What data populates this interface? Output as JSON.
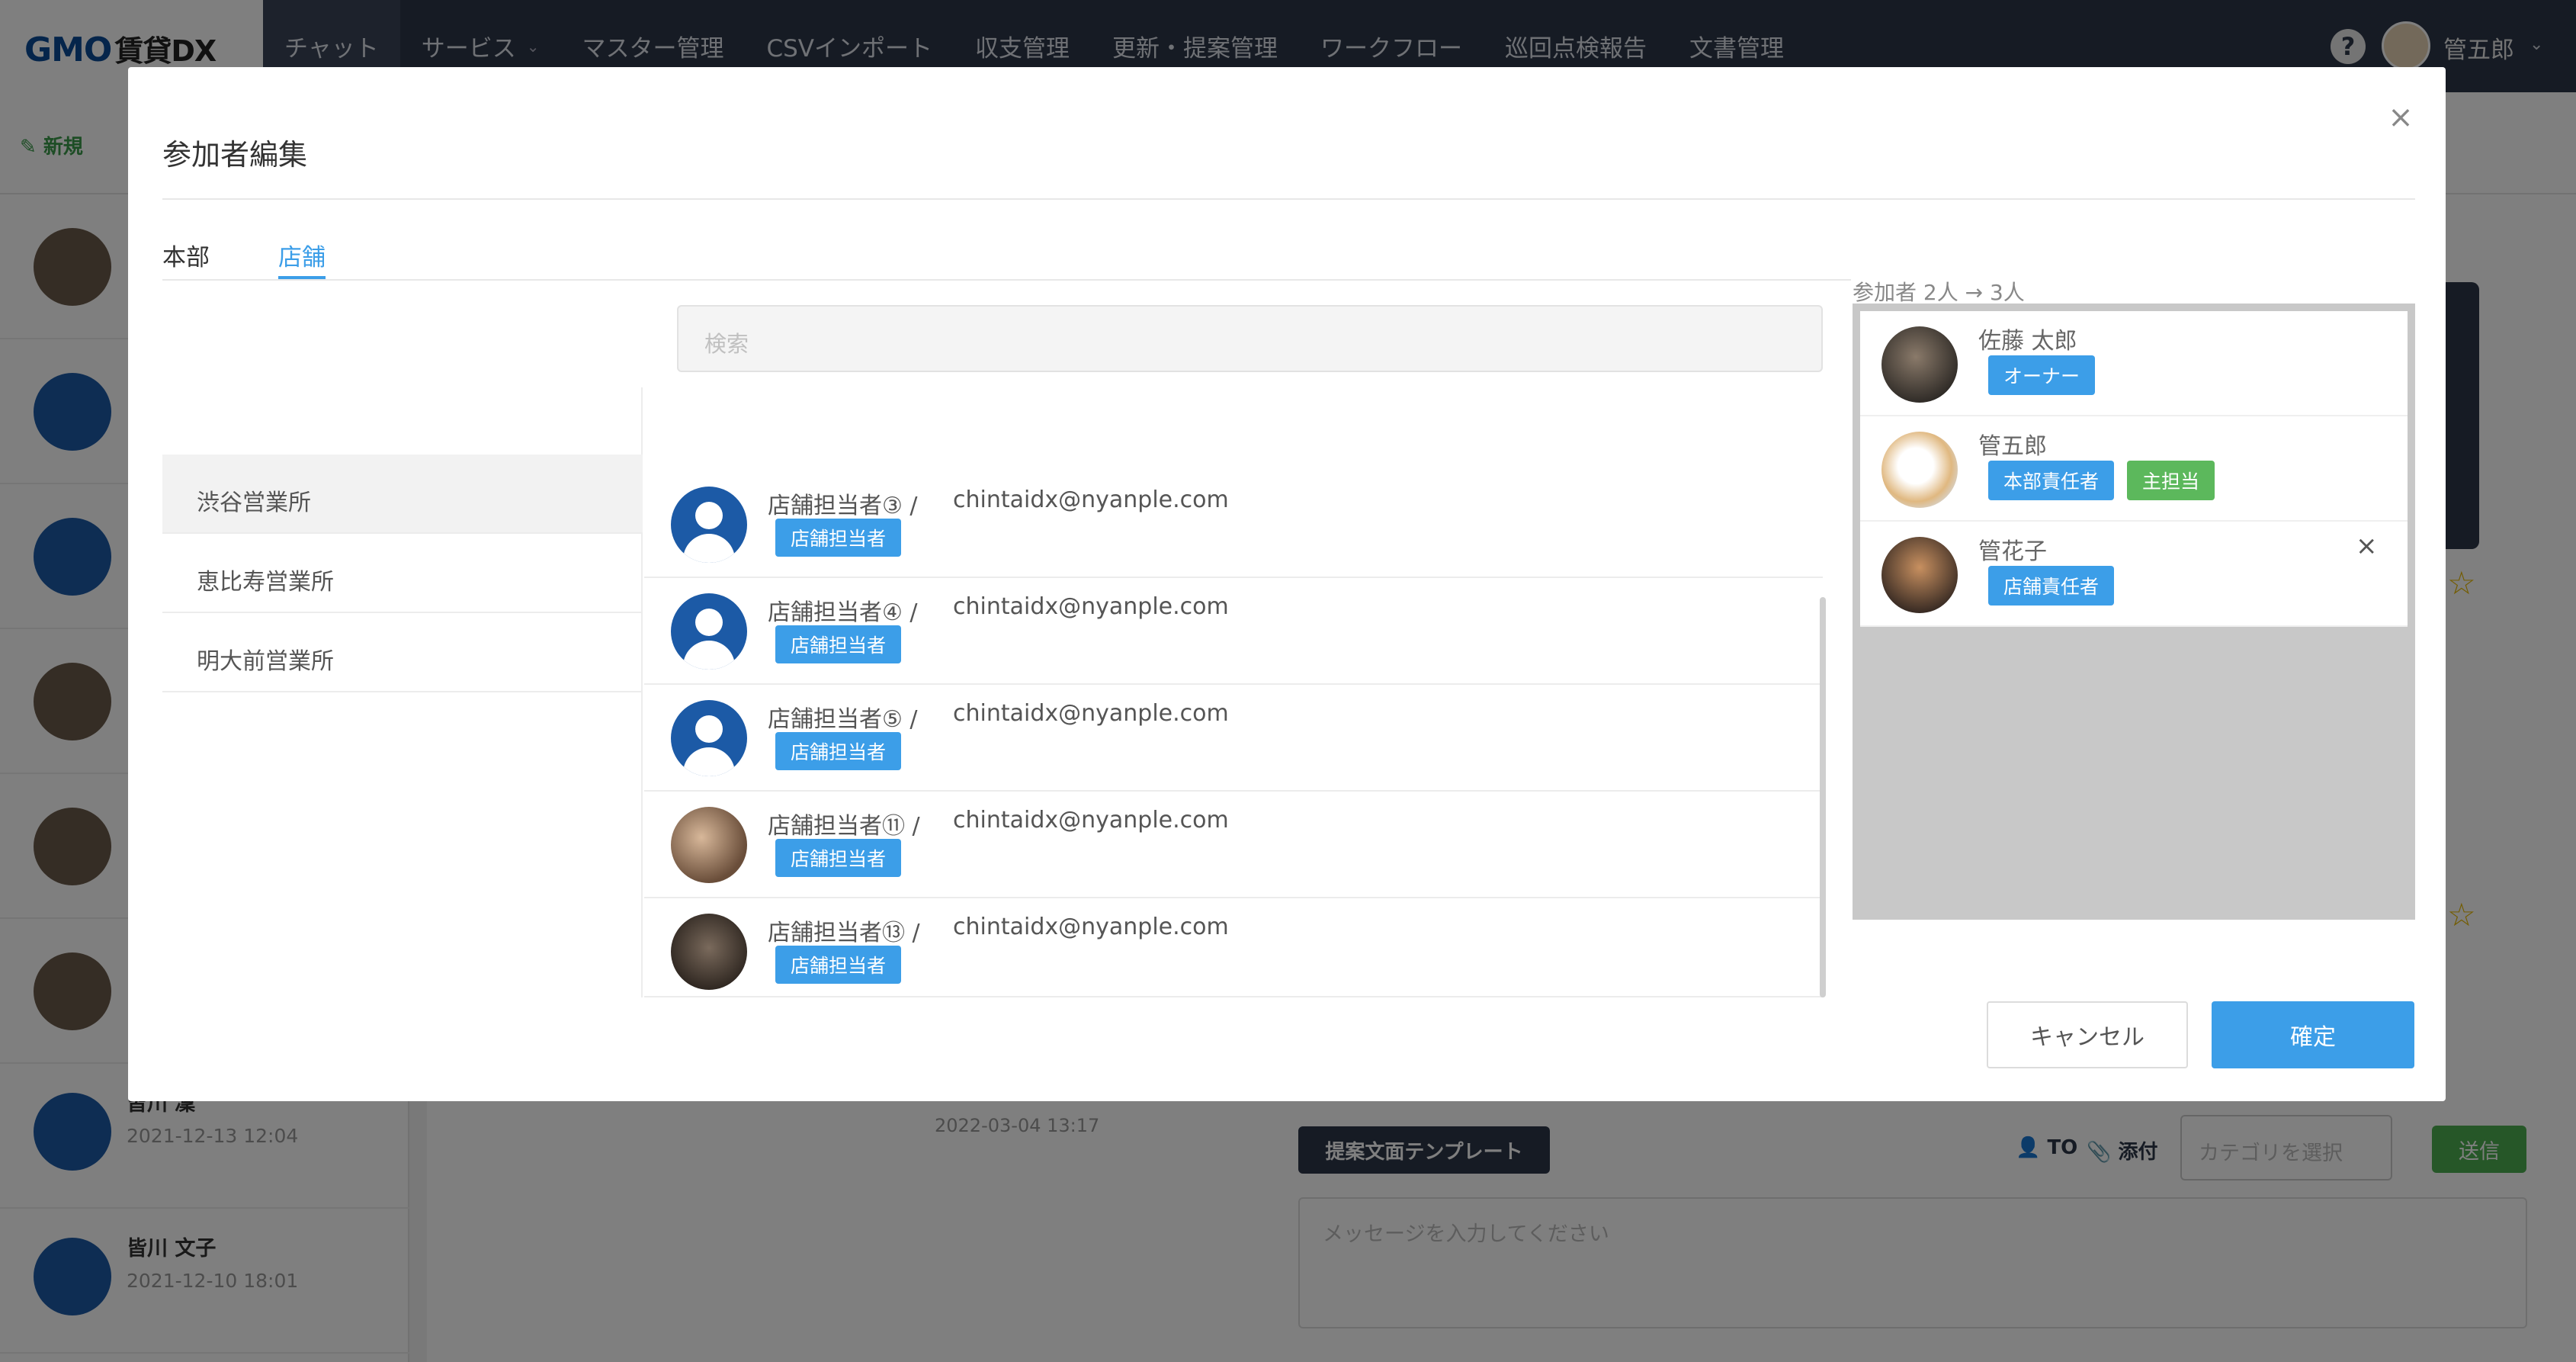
{
  "app": {
    "logo": "GMO",
    "logo_sub": "賃貸DX",
    "nav": [
      {
        "label": "チャット"
      },
      {
        "label": "サービス",
        "caret": "⌄"
      },
      {
        "label": "マスター管理"
      },
      {
        "label": "CSVインポート"
      },
      {
        "label": "収支管理"
      },
      {
        "label": "更新・提案管理"
      },
      {
        "label": "ワークフロー"
      },
      {
        "label": "巡回点検報告"
      },
      {
        "label": "文書管理"
      }
    ],
    "help_label": "?",
    "user_name": "管五郎"
  },
  "background": {
    "new_label": "新規",
    "conversations": [
      {
        "name": "皆川 凜",
        "date": "2021-12-13 12:04"
      },
      {
        "name": "皆川 文子",
        "date": "2021-12-10 18:01"
      }
    ],
    "message_date": "2022-03-04 13:17",
    "template_button": "提案文面テンプレート",
    "to_label": "TO",
    "attach_label": "添付",
    "category_placeholder": "カテゴリを選択",
    "send_label": "送信",
    "message_placeholder": "メッセージを入力してください"
  },
  "modal": {
    "title": "参加者編集",
    "tabs": [
      {
        "label": "本部",
        "active": false
      },
      {
        "label": "店舗",
        "active": true
      }
    ],
    "search_placeholder": "検索",
    "branches": [
      {
        "label": "渋谷営業所",
        "active": true
      },
      {
        "label": "恵比寿営業所",
        "active": false
      },
      {
        "label": "明大前営業所",
        "active": false
      }
    ],
    "members": [
      {
        "name": "店舗担当者③ /",
        "email": "chintaidx@nyanple.com",
        "badge": "店舗担当者",
        "avatar": "default-avatar-icon"
      },
      {
        "name": "店舗担当者④ /",
        "email": "chintaidx@nyanple.com",
        "badge": "店舗担当者",
        "avatar": "default-avatar-icon"
      },
      {
        "name": "店舗担当者⑤ /",
        "email": "chintaidx@nyanple.com",
        "badge": "店舗担当者",
        "avatar": "default-avatar-icon"
      },
      {
        "name": "店舗担当者⑪ /",
        "email": "chintaidx@nyanple.com",
        "badge": "店舗担当者",
        "avatar": "cat-photo"
      },
      {
        "name": "店舗担当者⑬ /",
        "email": "chintaidx@nyanple.com",
        "badge": "店舗担当者",
        "avatar": "cat-photo"
      }
    ],
    "participants_count": "参加者 2人 → 3人",
    "participants": [
      {
        "name": "佐藤 太郎",
        "badges": [
          {
            "label": "オーナー",
            "color": "#3c9ee8"
          }
        ],
        "removable": false
      },
      {
        "name": "管五郎",
        "badges": [
          {
            "label": "本部責任者",
            "color": "#3c9ee8"
          },
          {
            "label": "主担当",
            "color": "#5cb85c"
          }
        ],
        "removable": false
      },
      {
        "name": "管花子",
        "badges": [
          {
            "label": "店舗責任者",
            "color": "#3c9ee8"
          }
        ],
        "removable": true
      }
    ],
    "cancel_label": "キャンセル",
    "confirm_label": "確定",
    "close_icon": "×"
  },
  "colors": {
    "accent": "#3c9ee8",
    "header": "#2c3648",
    "green": "#5cb85c"
  }
}
